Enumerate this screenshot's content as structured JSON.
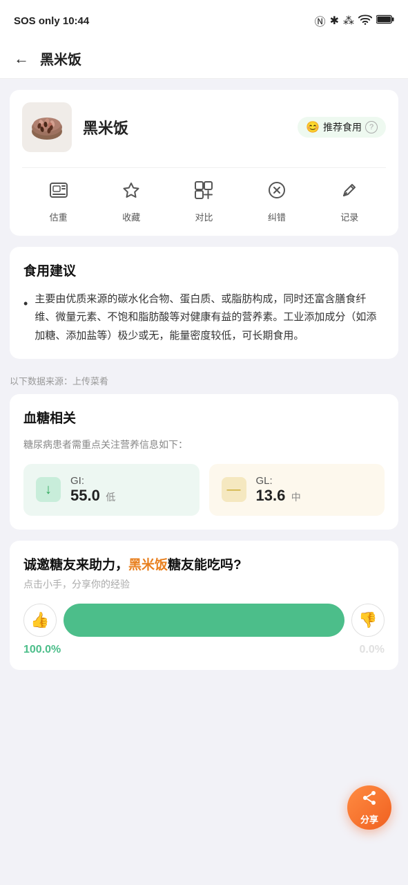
{
  "statusBar": {
    "left": "SOS only  10:44",
    "icons": [
      "nfc",
      "bluetooth",
      "signal",
      "wifi",
      "battery"
    ]
  },
  "header": {
    "back": "←",
    "title": "黑米饭"
  },
  "foodCard": {
    "name": "黑米饭",
    "recommendBadge": "推荐食用",
    "helpIcon": "?",
    "actions": [
      {
        "id": "estimate",
        "label": "估重",
        "icon": "🖼"
      },
      {
        "id": "collect",
        "label": "收藏",
        "icon": "☆"
      },
      {
        "id": "compare",
        "label": "对比",
        "icon": "⊞"
      },
      {
        "id": "correct",
        "label": "纠错",
        "icon": "⊗"
      },
      {
        "id": "record",
        "label": "记录",
        "icon": "✏"
      }
    ]
  },
  "adviceCard": {
    "title": "食用建议",
    "content": "主要由优质来源的碳水化合物、蛋白质、或脂肪构成，同时还富含膳食纤维、微量元素、不饱和脂肪酸等对健康有益的营养素。工业添加成分（如添加糖、添加盐等）极少或无，能量密度较低，可长期食用。"
  },
  "dataSource": {
    "text": "以下数据来源：上传菜肴"
  },
  "bloodSugar": {
    "title": "血糖相关",
    "subtitle": "糖尿病患者需重点关注营养信息如下：",
    "gi": {
      "label": "GI:",
      "value": "55.0",
      "level": "低",
      "arrow": "↓",
      "color": "green"
    },
    "gl": {
      "label": "GL:",
      "value": "13.6",
      "level": "中",
      "arrow": "—",
      "color": "yellow"
    }
  },
  "community": {
    "title1": "诚邀糖友来助力，",
    "titleHighlight": "黑米饭",
    "title2": "糖友能吃吗?",
    "subtitle": "点击小手，分享你的经验",
    "yesPercent": "100.0%",
    "noPercent": "0.0%"
  },
  "fab": {
    "icon": "↗",
    "label": "分享"
  }
}
